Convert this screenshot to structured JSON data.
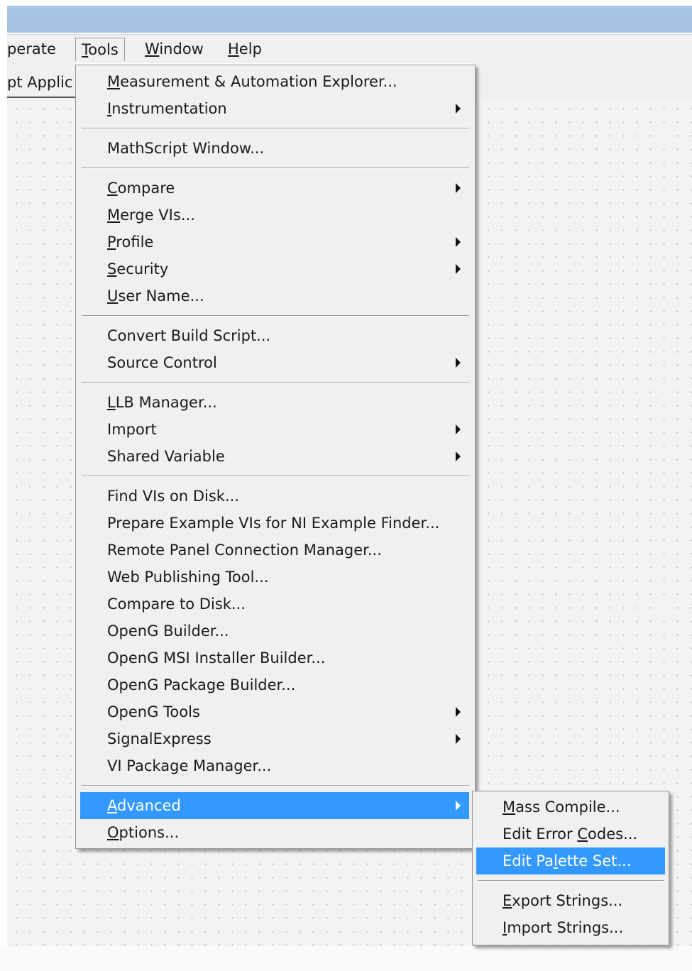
{
  "menubar": {
    "items": [
      {
        "label": "Operate",
        "underline": 0,
        "visible_from": 1
      },
      {
        "label": "Tools",
        "underline": 0
      },
      {
        "label": "Window",
        "underline": 0
      },
      {
        "label": "Help",
        "underline": 0
      }
    ]
  },
  "toolbar": {
    "left_text": "pt Applic"
  },
  "tools_menu": {
    "items": [
      {
        "label": "Measurement & Automation Explorer...",
        "underline": 0,
        "submenu": false
      },
      {
        "label": "Instrumentation",
        "underline": 0,
        "submenu": true
      },
      {
        "separator": true
      },
      {
        "label": "MathScript Window...",
        "underline": -1,
        "submenu": false
      },
      {
        "separator": true
      },
      {
        "label": "Compare",
        "underline": 0,
        "submenu": true
      },
      {
        "label": "Merge VIs...",
        "underline": 0,
        "submenu": false
      },
      {
        "label": "Profile",
        "underline": 0,
        "submenu": true
      },
      {
        "label": "Security",
        "underline": 0,
        "submenu": true
      },
      {
        "label": "User Name...",
        "underline": 0,
        "submenu": false
      },
      {
        "separator": true
      },
      {
        "label": "Convert Build Script...",
        "underline": -1,
        "submenu": false
      },
      {
        "label": "Source Control",
        "underline": -1,
        "submenu": true
      },
      {
        "separator": true
      },
      {
        "label": "LLB Manager...",
        "underline": 0,
        "submenu": false
      },
      {
        "label": "Import",
        "underline": -1,
        "submenu": true
      },
      {
        "label": "Shared Variable",
        "underline": -1,
        "submenu": true
      },
      {
        "separator": true
      },
      {
        "label": "Find VIs on Disk...",
        "underline": -1,
        "submenu": false
      },
      {
        "label": "Prepare Example VIs for NI Example Finder...",
        "underline": -1,
        "submenu": false
      },
      {
        "label": "Remote Panel Connection Manager...",
        "underline": -1,
        "submenu": false
      },
      {
        "label": "Web Publishing Tool...",
        "underline": -1,
        "submenu": false
      },
      {
        "label": "Compare to Disk...",
        "underline": -1,
        "submenu": false
      },
      {
        "label": "OpenG Builder...",
        "underline": -1,
        "submenu": false
      },
      {
        "label": "OpenG MSI Installer Builder...",
        "underline": -1,
        "submenu": false
      },
      {
        "label": "OpenG Package Builder...",
        "underline": -1,
        "submenu": false
      },
      {
        "label": "OpenG Tools",
        "underline": -1,
        "submenu": true
      },
      {
        "label": "SignalExpress",
        "underline": -1,
        "submenu": true
      },
      {
        "label": "VI Package Manager...",
        "underline": -1,
        "submenu": false
      },
      {
        "separator": true
      },
      {
        "label": "Advanced",
        "underline": 0,
        "submenu": true,
        "highlighted": true
      },
      {
        "label": "Options...",
        "underline": 0,
        "submenu": false
      }
    ]
  },
  "advanced_menu": {
    "items": [
      {
        "label": "Mass Compile...",
        "underline": 0
      },
      {
        "label": "Edit Error Codes...",
        "underline": 11
      },
      {
        "label": "Edit Palette Set...",
        "underline": 7,
        "highlighted": true
      },
      {
        "separator": true
      },
      {
        "label": "Export Strings...",
        "underline": 0
      },
      {
        "label": "Import Strings...",
        "underline": 0
      }
    ]
  },
  "colors": {
    "highlight": "#3399ff",
    "menu_background": "#f0f0f0",
    "title_bar": "#a9c4e4"
  }
}
